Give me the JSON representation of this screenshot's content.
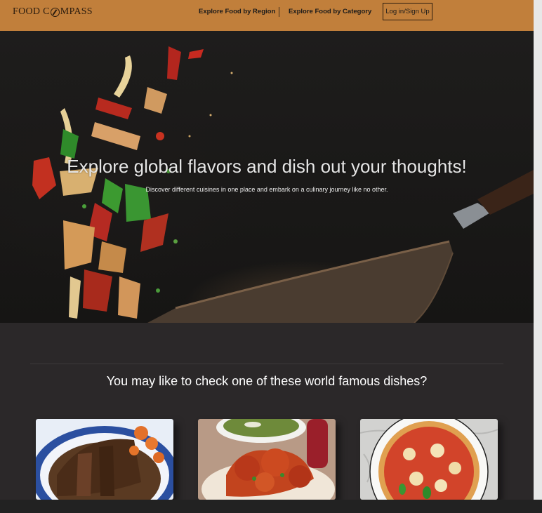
{
  "navbar": {
    "logo_left": "FOOD C",
    "logo_right": "MPASS",
    "links": [
      "Explore Food by Region",
      "Explore Food by Category"
    ],
    "login_label": "Log in/Sign Up",
    "bg_color": "#c17f3b"
  },
  "hero": {
    "title": "Explore global flavors and dish out your thoughts!",
    "subtitle": "Discover different cuisines in one place and embark on a culinary journey like no other."
  },
  "dishes_section": {
    "title": "You may like to check one of these world famous dishes?",
    "cards": [
      {
        "image": "roast-beef-platter"
      },
      {
        "image": "tandoori-chicken-with-green-curry"
      },
      {
        "image": "margherita-pizza"
      }
    ]
  }
}
